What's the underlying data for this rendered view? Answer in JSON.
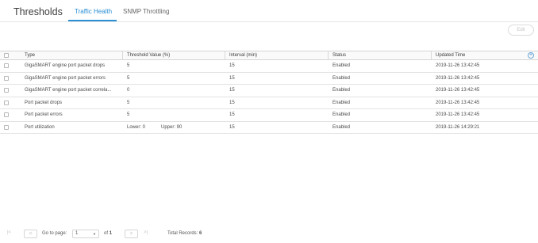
{
  "header": {
    "title": "Thresholds",
    "tabs": [
      {
        "label": "Traffic Health",
        "active": true
      },
      {
        "label": "SNMP Throttling",
        "active": false
      }
    ]
  },
  "toolbar": {
    "edit_label": "Edit"
  },
  "table": {
    "columns": [
      "Type",
      "Threshold Value (%)",
      "Interval (min)",
      "Status",
      "Updated Time"
    ],
    "rows": [
      {
        "type": "GigaSMART engine port packet drops",
        "threshold": "5",
        "interval": "15",
        "status": "Enabled",
        "updated": "2019-11-26 13:42:45"
      },
      {
        "type": "GigaSMART engine port packet errors",
        "threshold": "5",
        "interval": "15",
        "status": "Enabled",
        "updated": "2019-11-26 13:42:45"
      },
      {
        "type": "GigaSMART engine port packet correla...",
        "threshold": "0",
        "interval": "15",
        "status": "Enabled",
        "updated": "2019-11-26 13:42:45"
      },
      {
        "type": "Port packet drops",
        "threshold": "5",
        "interval": "15",
        "status": "Enabled",
        "updated": "2019-11-26 13:42:45"
      },
      {
        "type": "Port packet errors",
        "threshold": "5",
        "interval": "15",
        "status": "Enabled",
        "updated": "2019-11-26 13:42:45"
      },
      {
        "type": "Port utilization",
        "threshold": "Lower: 0",
        "threshold_upper": "Upper: 90",
        "interval": "15",
        "status": "Enabled",
        "updated": "2019-11-26 14:29:21"
      }
    ]
  },
  "pagination": {
    "go_to_label": "Go to page:",
    "current_page": "1",
    "of_label": "of",
    "total_pages": "1",
    "total_label": "Total Records:",
    "total_records": "6",
    "first_icon": "first-page-icon",
    "prev_icon": "chevron-left-icon",
    "next_icon": "chevron-right-icon",
    "last_icon": "last-page-icon"
  },
  "colors": {
    "accent": "#2a8fd4"
  }
}
